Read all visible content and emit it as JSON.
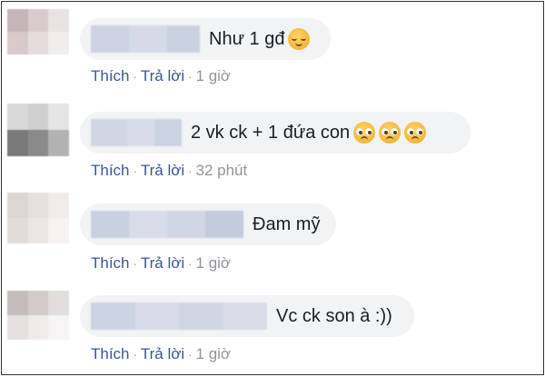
{
  "comments": [
    {
      "text": "Như 1 gđ",
      "emojis": [
        "relieved-face-icon"
      ],
      "like_label": "Thích",
      "reply_label": "Trả lời",
      "time": "1 giờ"
    },
    {
      "text": "2 vk ck + 1 đứa con",
      "emojis": [
        "pleading-face-icon",
        "pleading-face-icon",
        "pleading-face-icon"
      ],
      "like_label": "Thích",
      "reply_label": "Trả lời",
      "time": "32 phút"
    },
    {
      "text": "Đam mỹ",
      "emojis": [],
      "like_label": "Thích",
      "reply_label": "Trả lời",
      "time": "1 giờ"
    },
    {
      "text": "Vc ck son à :))",
      "emojis": [],
      "like_label": "Thích",
      "reply_label": "Trả lời",
      "time": "1 giờ"
    }
  ],
  "separator": "·",
  "colors": {
    "link": "#385898",
    "meta": "#90949c",
    "bubble": "#f2f3f5",
    "text": "#1c1e21"
  }
}
